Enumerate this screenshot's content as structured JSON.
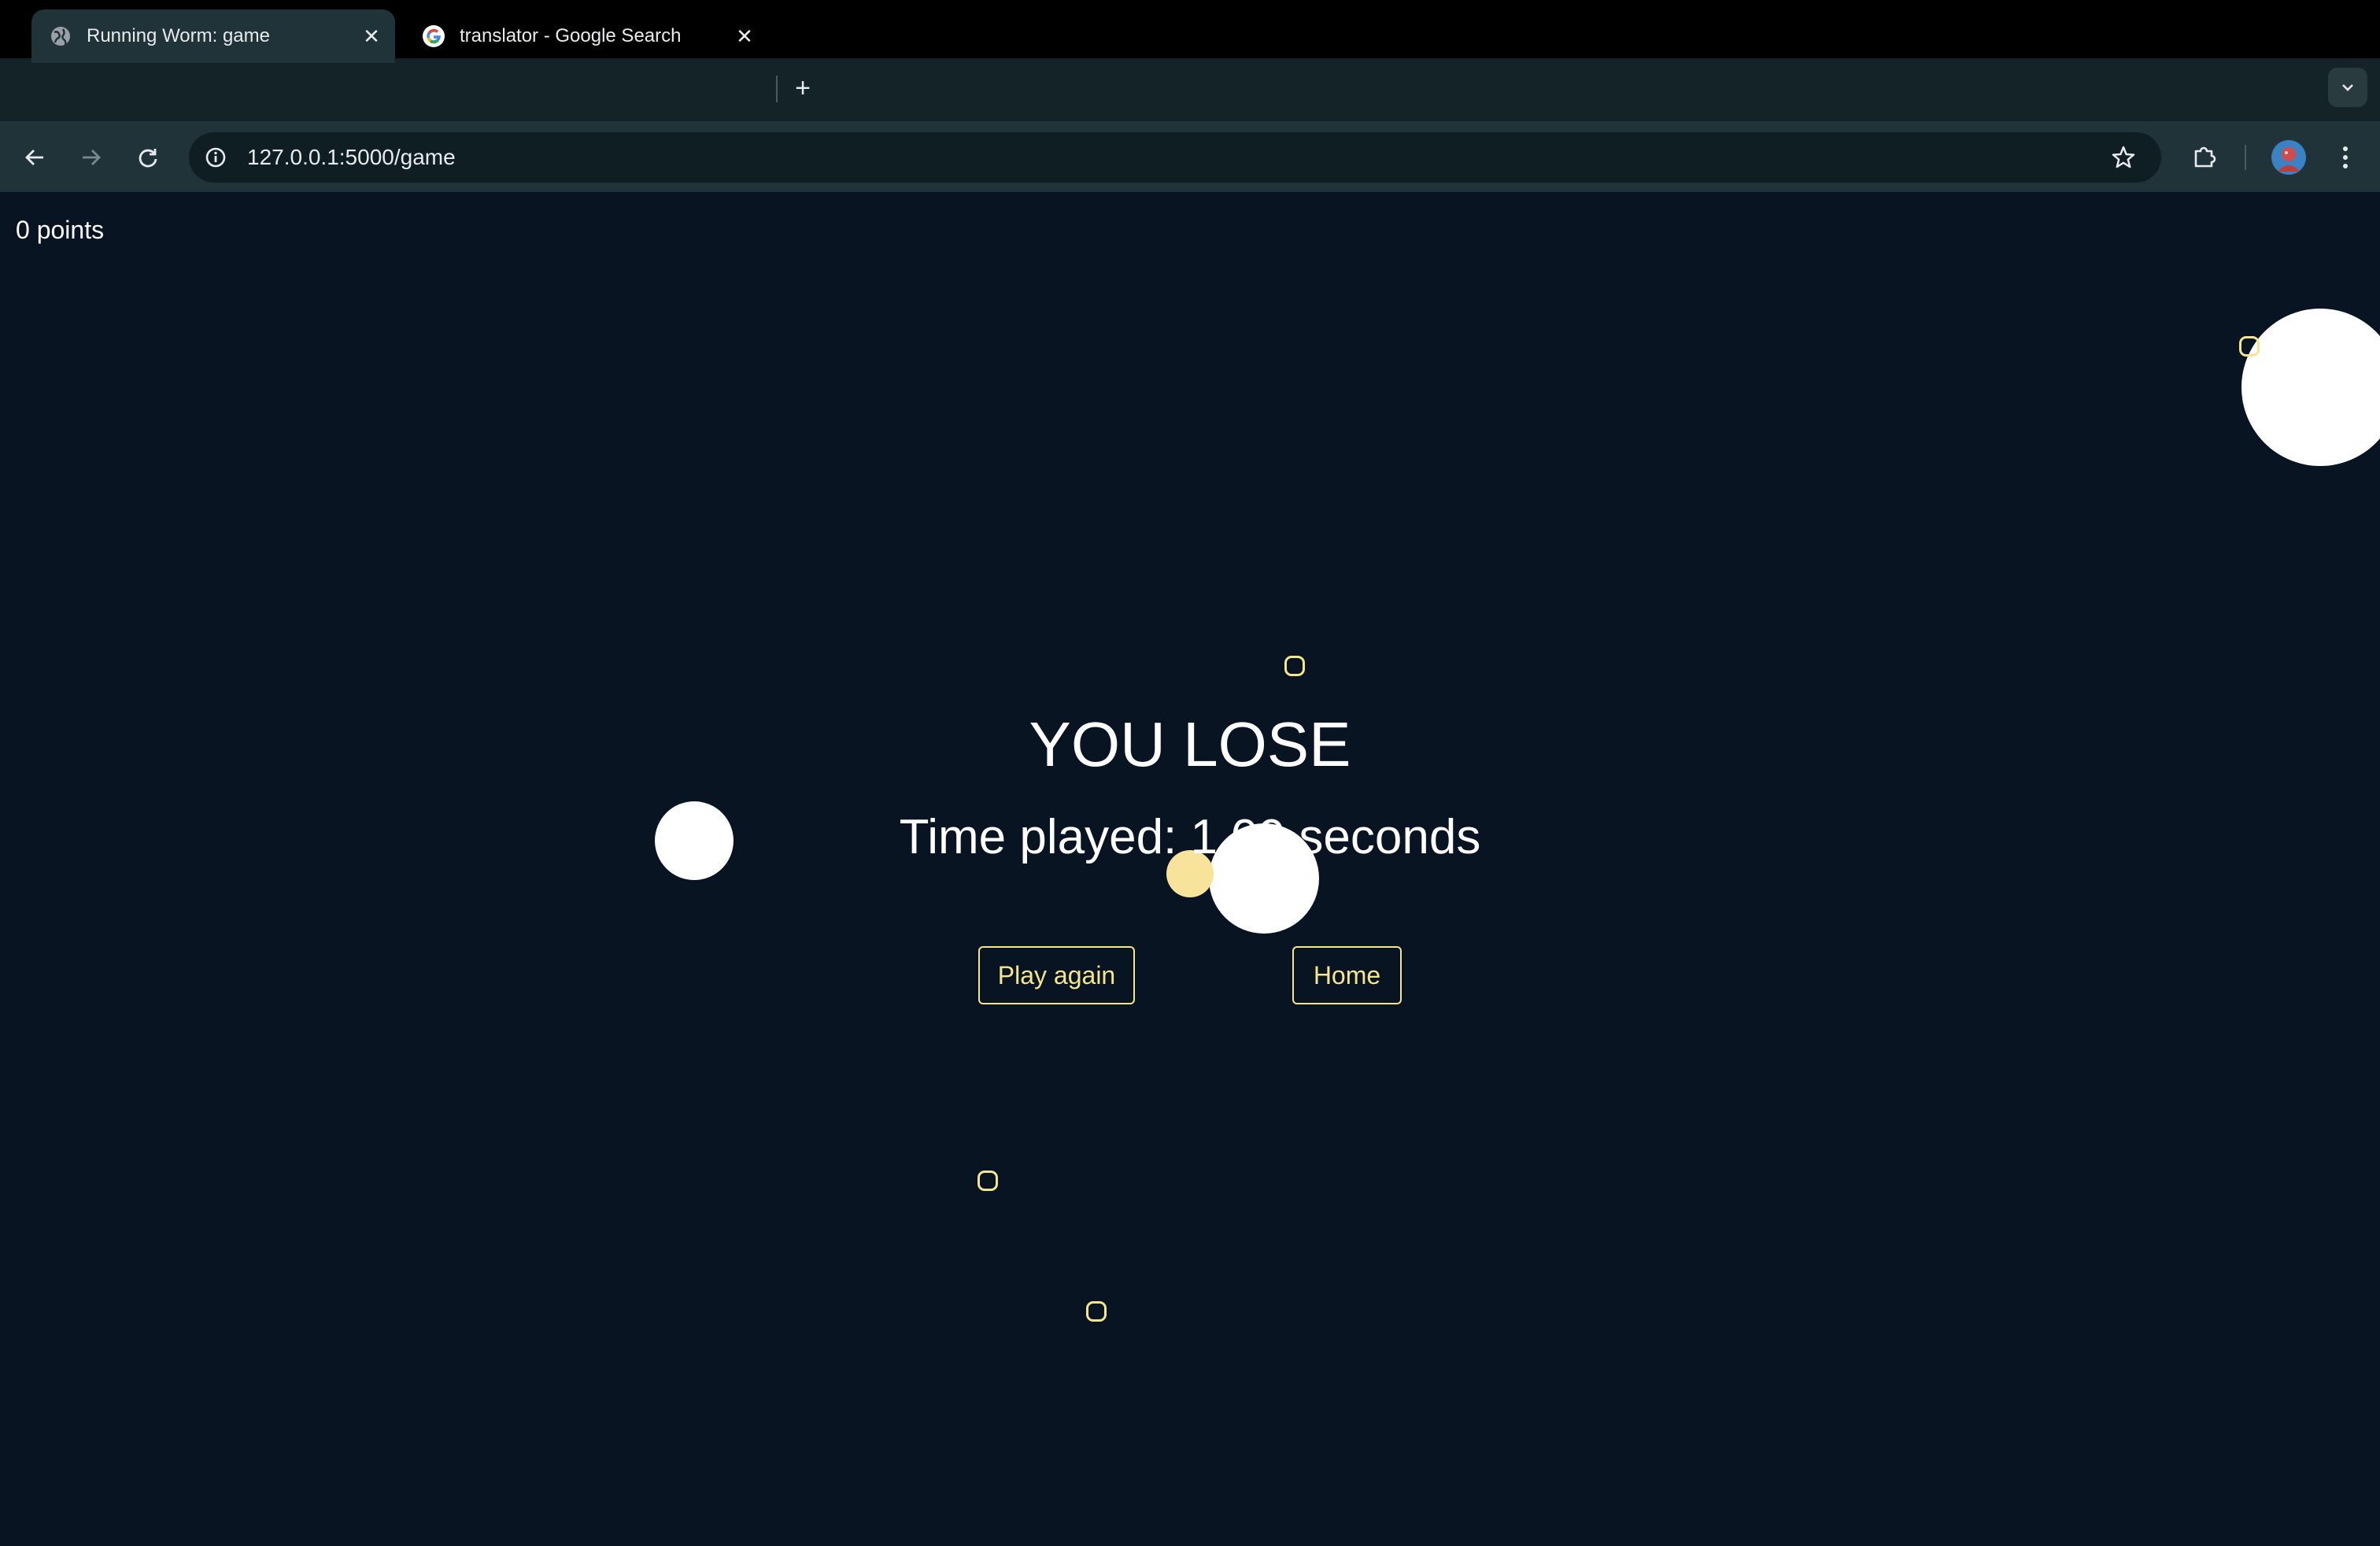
{
  "browser": {
    "tabs": [
      {
        "title": "Running Worm: game",
        "active": true,
        "favicon": "globe-icon"
      },
      {
        "title": "translator - Google Search",
        "active": false,
        "favicon": "google-g-icon"
      }
    ],
    "address": "127.0.0.1:5000/game"
  },
  "game": {
    "score_label": "0 points",
    "headline": "YOU LOSE",
    "time_played": "Time played: 1.09 seconds",
    "buttons": {
      "play_again": "Play again",
      "home": "Home"
    }
  },
  "colors": {
    "background": "#081421",
    "accent": "#f4e58f",
    "ball": "#ffffff",
    "worm": "#f7e39a"
  }
}
